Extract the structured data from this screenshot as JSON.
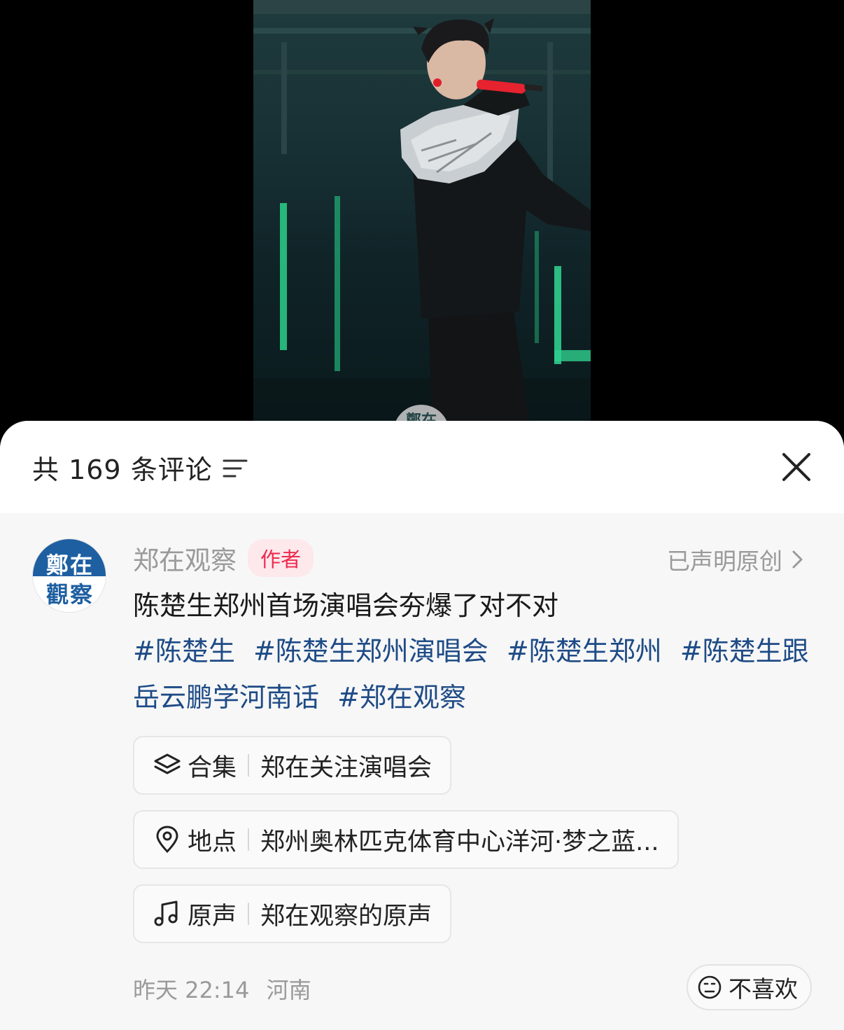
{
  "video": {
    "watermark_text": "鄭在"
  },
  "comments_header": {
    "count_label": "共 169 条评论"
  },
  "post": {
    "avatar_line1": "鄭在",
    "avatar_line2": "觀察",
    "username": "郑在观察",
    "author_badge": "作者",
    "original_claim": "已声明原创",
    "text": "陈楚生郑州首场演唱会夯爆了对不对",
    "hashtags": [
      "#陈楚生",
      "#陈楚生郑州演唱会",
      "#陈楚生郑州",
      "#陈楚生跟岳云鹏学河南话",
      "#郑在观察"
    ],
    "collection": {
      "type": "合集",
      "value": "郑在关注演唱会"
    },
    "location": {
      "type": "地点",
      "value": "郑州奥林匹克体育中心洋河·梦之蓝..."
    },
    "music": {
      "type": "原声",
      "value": "郑在观察的原声"
    },
    "time": "昨天 22:14",
    "region": "河南",
    "dislike_label": "不喜欢"
  },
  "colors": {
    "author_badge_text": "#ef2a4e",
    "author_badge_bg": "#fde8ec",
    "hashtag": "#1e4b86",
    "avatar_blue": "#1e5fa1"
  }
}
